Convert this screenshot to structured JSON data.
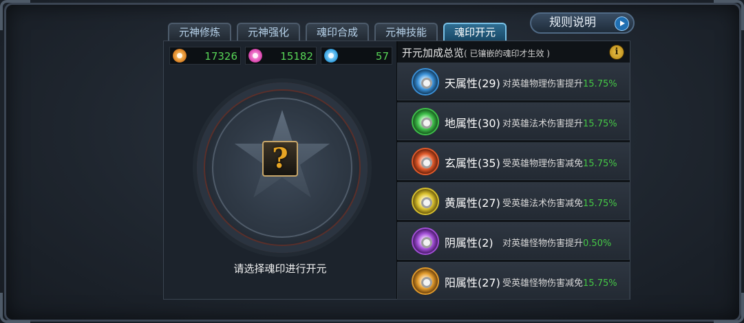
{
  "tabs": [
    {
      "label": "元神修炼",
      "active": false
    },
    {
      "label": "元神强化",
      "active": false
    },
    {
      "label": "魂印合成",
      "active": false
    },
    {
      "label": "元神技能",
      "active": false
    },
    {
      "label": "魂印开元",
      "active": true
    }
  ],
  "rules_button": {
    "label": "规则说明"
  },
  "currencies": [
    {
      "icon": "orange-orb-icon",
      "value": "17326",
      "color": "#e08a2c"
    },
    {
      "icon": "pink-orb-icon",
      "value": "15182",
      "color": "#e04fb5"
    },
    {
      "icon": "blue-orb-icon",
      "value": "57",
      "color": "#3ea9e6"
    }
  ],
  "altar": {
    "hint": "请选择魂印进行开元",
    "placeholder_icon": "question-mark-icon",
    "placeholder_glyph": "?"
  },
  "summary": {
    "title": "开元加成总览",
    "note": "( 已镶嵌的魂印才生效 )",
    "info_glyph": "i",
    "rows": [
      {
        "name": "天属性(29)",
        "desc": "对英雄物理伤害提升",
        "pct": "15.75%",
        "color": "#3a8fd6"
      },
      {
        "name": "地属性(30)",
        "desc": "对英雄法术伤害提升",
        "pct": "15.75%",
        "color": "#3fbf4a"
      },
      {
        "name": "玄属性(35)",
        "desc": "受英雄物理伤害减免",
        "pct": "15.75%",
        "color": "#e05a2a"
      },
      {
        "name": "黄属性(27)",
        "desc": "受英雄法术伤害减免",
        "pct": "15.75%",
        "color": "#d9c02e"
      },
      {
        "name": "阴属性(2)",
        "desc": "对英雄怪物伤害提升",
        "pct": "0.50%",
        "color": "#a24fd6"
      },
      {
        "name": "阳属性(27)",
        "desc": "受英雄怪物伤害减免",
        "pct": "15.75%",
        "color": "#e09a2c"
      }
    ]
  }
}
